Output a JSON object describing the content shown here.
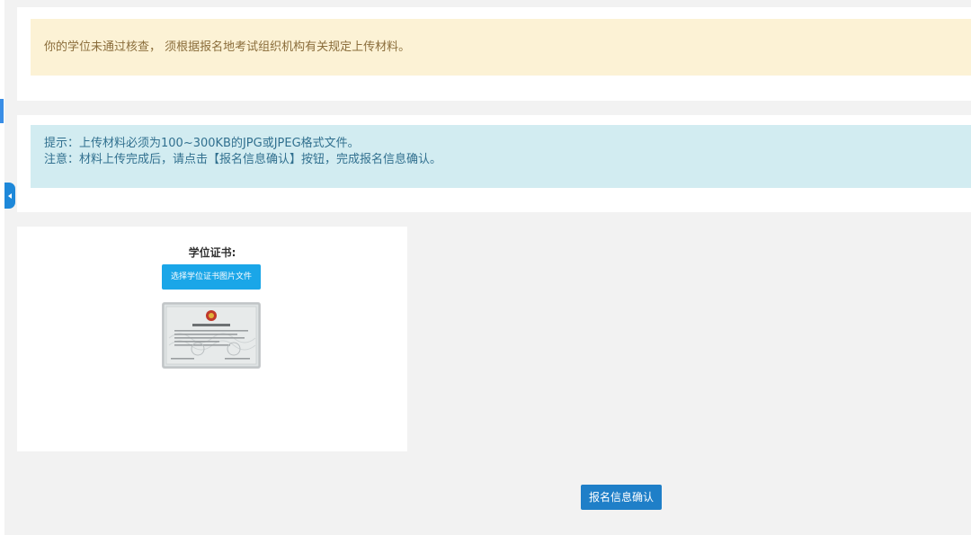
{
  "alerts": {
    "warning_text": "你的学位未通过核查， 须根据报名地考试组织机构有关规定上传材料。",
    "tip_line": "提示：上传材料必须为100~300KB的JPG或JPEG格式文件。",
    "note_line": "注意：材料上传完成后，请点击【报名信息确认】按钮，完成报名信息确认。"
  },
  "upload": {
    "title": "学位证书:",
    "button_label": "选择学位证书图片文件",
    "thumbnail_icon": "degree-certificate-image"
  },
  "actions": {
    "confirm_label": "报名信息确认"
  },
  "colors": {
    "warning_bg": "#fcf2d5",
    "warning_text": "#8a6d3b",
    "info_bg": "#d2ecf1",
    "info_text": "#31708f",
    "upload_button": "#1aa6e8",
    "confirm_button": "#1f7fc8"
  }
}
